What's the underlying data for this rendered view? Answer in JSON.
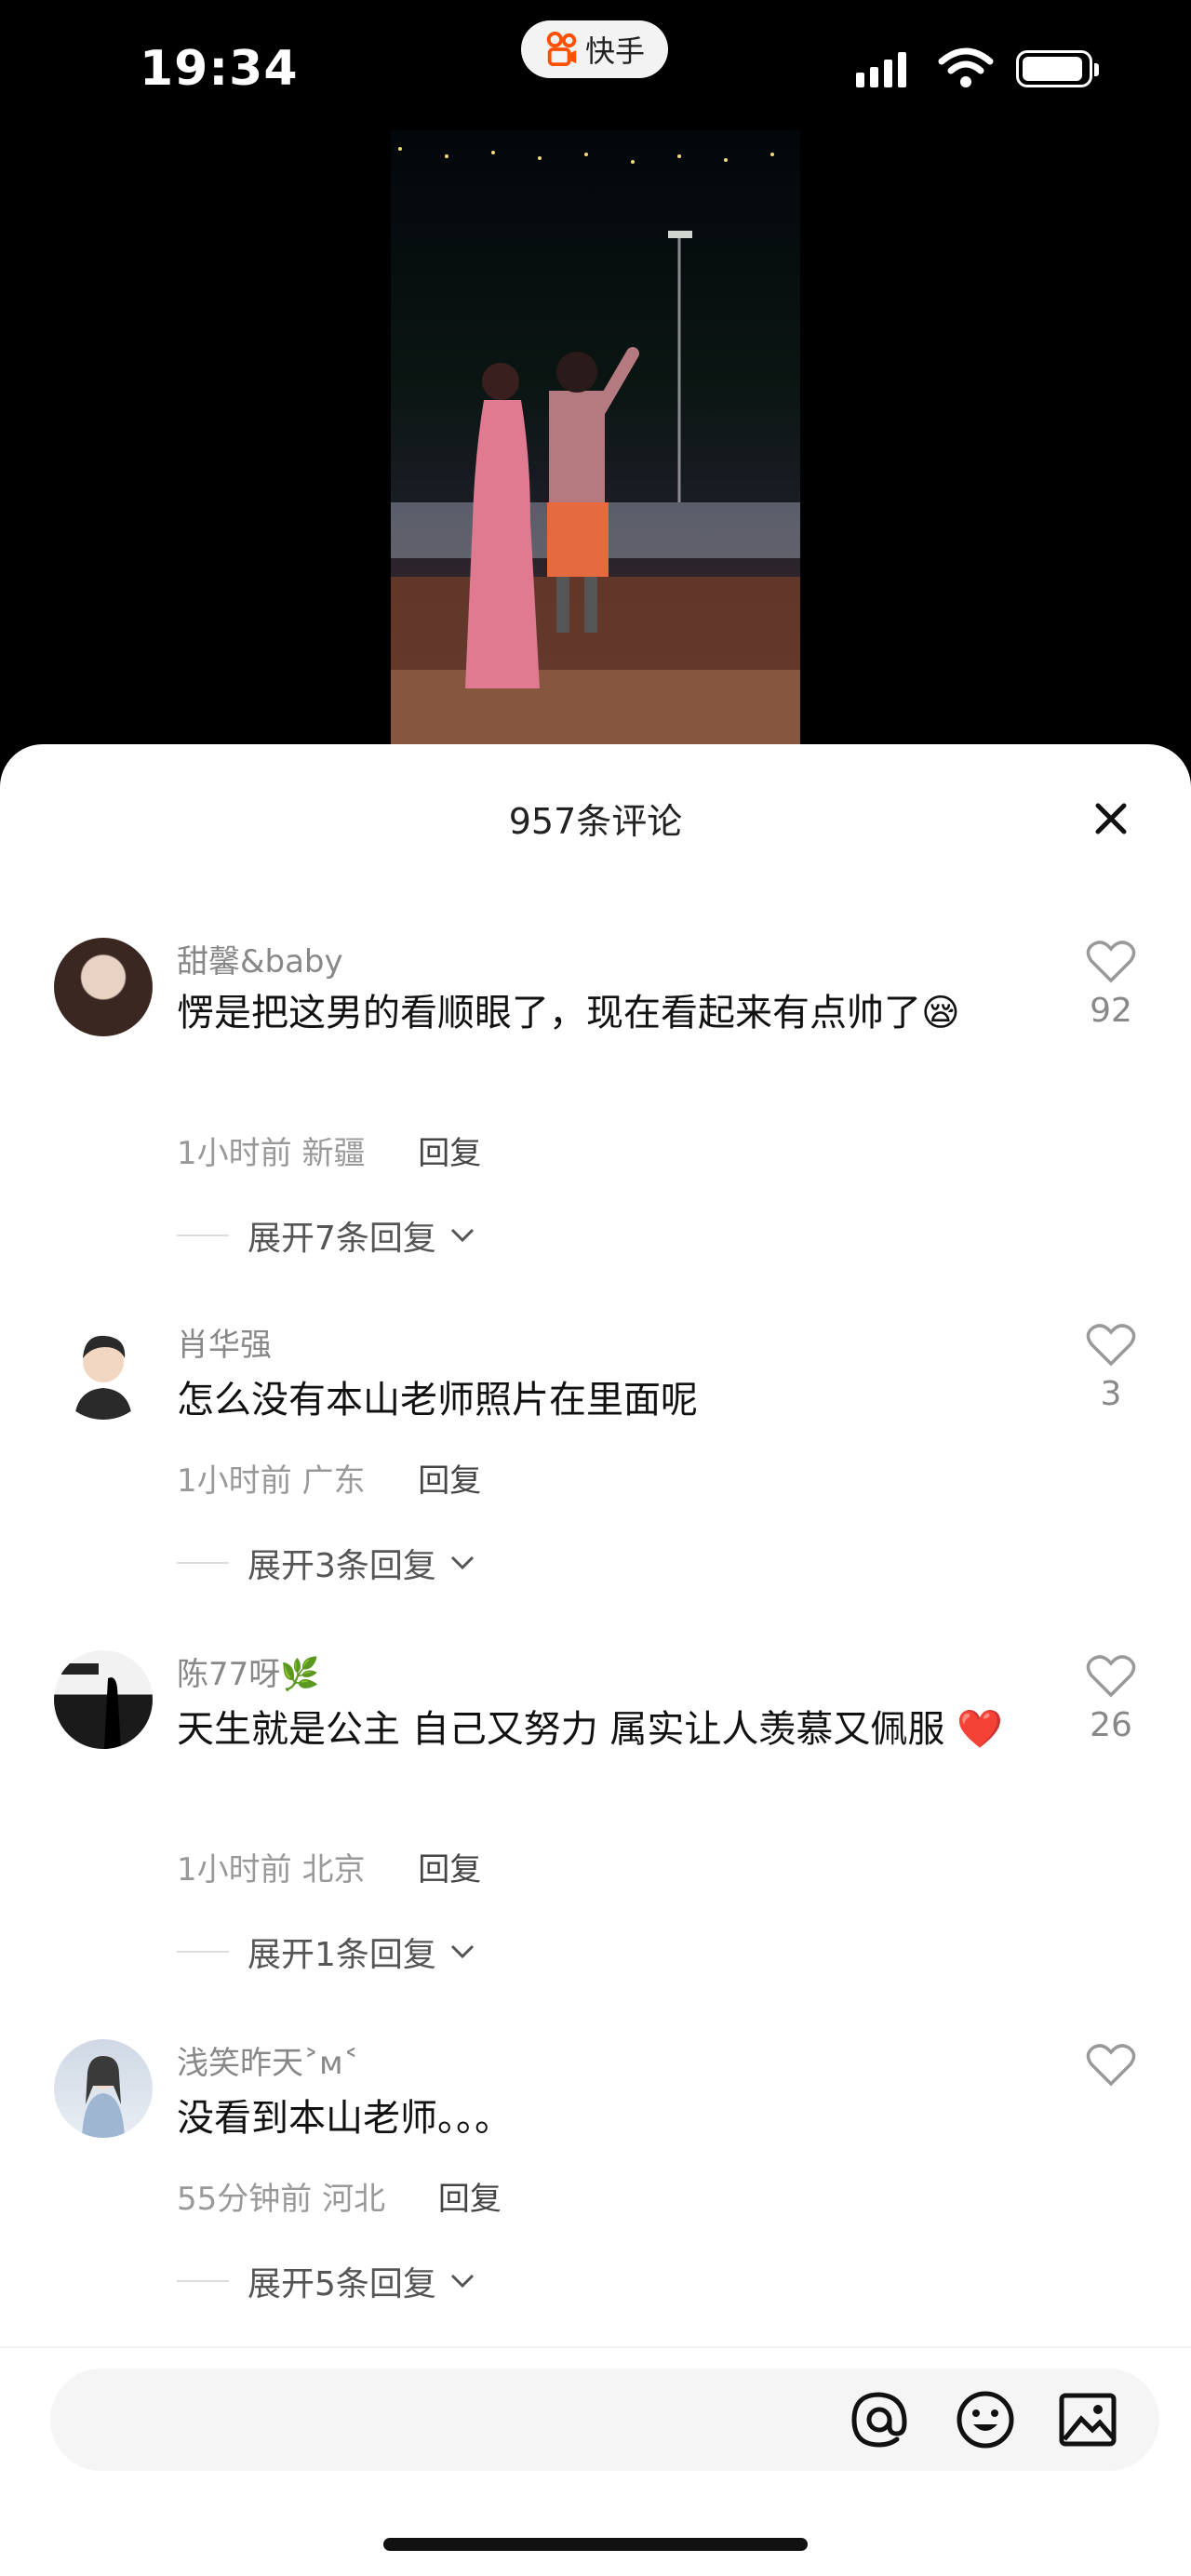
{
  "status": {
    "time": "19:34",
    "app_name": "快手"
  },
  "sheet": {
    "title": "957条评论",
    "input_placeholder": ""
  },
  "comments": [
    {
      "username": "甜馨&baby",
      "text": "愣是把这男的看顺眼了，现在看起来有点帅了😪",
      "time": "1小时前",
      "location": "新疆",
      "reply_label": "回复",
      "expand_label": "展开7条回复",
      "likes": "92"
    },
    {
      "username": "肖华强",
      "text": "怎么没有本山老师照片在里面呢",
      "time": "1小时前",
      "location": "广东",
      "reply_label": "回复",
      "expand_label": "展开3条回复",
      "likes": "3"
    },
    {
      "username": "陈77呀🌿",
      "text": "天生就是公主  自己又努力 属实让人羡慕又佩服 ❤️",
      "time": "1小时前",
      "location": "北京",
      "reply_label": "回复",
      "expand_label": "展开1条回复",
      "likes": "26"
    },
    {
      "username": "浅笑昨天˃ᴍ˂",
      "text": "没看到本山老师。。。",
      "time": "55分钟前",
      "location": "河北",
      "reply_label": "回复",
      "expand_label": "展开5条回复",
      "likes": ""
    }
  ],
  "icons": [
    "signal-icon",
    "wifi-icon",
    "battery-icon",
    "close-icon",
    "heart-icon",
    "at-icon",
    "emoji-icon",
    "image-icon",
    "chevron-down-icon"
  ],
  "colors": {
    "sheet_bg": "#ffffff",
    "username": "#888888",
    "meta": "#999999",
    "brand": "#ff5000"
  }
}
